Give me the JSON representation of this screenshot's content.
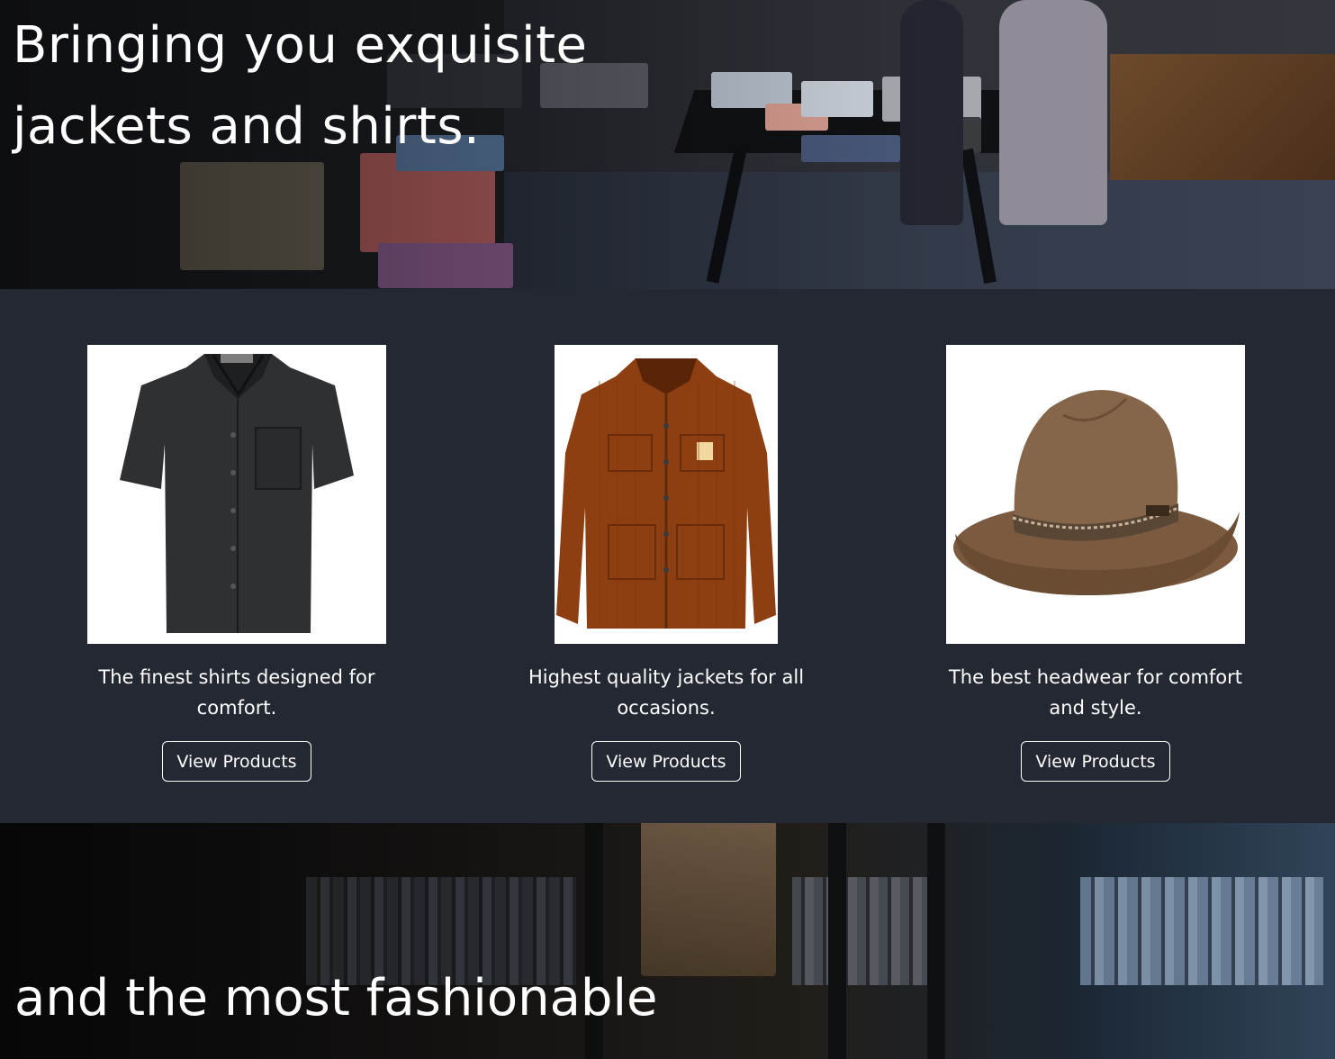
{
  "hero_top": {
    "title_line1": "Bringing you exquisite",
    "title_line2": "jackets and shirts."
  },
  "products": [
    {
      "caption": "The finest shirts designed for comfort.",
      "button_label": "View Products",
      "image": "black-shirt-image"
    },
    {
      "caption": "Highest quality jackets for all occasions.",
      "button_label": "View Products",
      "image": "brown-corduroy-jacket-image"
    },
    {
      "caption": "The best headwear for comfort and style.",
      "button_label": "View Products",
      "image": "brown-fedora-hat-image"
    }
  ],
  "hero_bottom": {
    "title": "and the most fashionable"
  },
  "colors": {
    "section_bg": "#242833",
    "text": "#ffffff",
    "button_border": "#ffffff"
  }
}
